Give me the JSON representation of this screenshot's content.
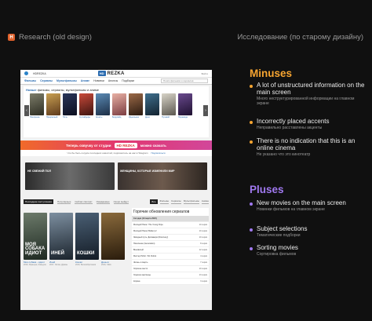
{
  "header": {
    "left_badge": "H",
    "left_label": "Research (old design)",
    "right_label": "Исследование (по старому дизайну)"
  },
  "site": {
    "top_left_text": "HDREZKA",
    "brand_badge": "HD",
    "brand_name": "REZKA",
    "top_right_text": "Войти",
    "nav": [
      "Фильмы",
      "Сериалы",
      "Мультфильмы",
      "Аниме",
      "Новинки",
      "Анонсы",
      "Подборки"
    ],
    "search_placeholder": "Поиск фильмов и сериалов",
    "new_title_prefix": "Новые",
    "new_title_rest": "фильмы, сериалы, мультфильмы и аниме",
    "poster_captions": [
      "Покорение",
      "Прекрасный",
      "Ночь",
      "Аутсайдеры",
      "Агенты",
      "Бердсайд",
      "Идеальная",
      "Дело",
      "Нулевой",
      "Пирамида"
    ],
    "banner_text": "Теперь озвучку от студии",
    "banner_logo": "HD REZKA",
    "banner_suffix": "можно скачать",
    "tg_text": "Что бы быть в курсе последних новостей, подпишитесь на нас в Telegram",
    "tg_subscribe": "Подписаться",
    "collections": [
      "НЕ СВЕЖИЙ ПОЛ",
      "ЖЕНЩИНЫ, КОТОРЫЕ ИЗМЕНИЛИ МИР"
    ],
    "tabs": [
      "Последние поступления",
      "Популярные",
      "Сейчас смотрят",
      "Ожидаемые",
      "Скоро выйдут"
    ],
    "tabs_right": [
      "Все",
      "Фильмы",
      "Сериалы",
      "Мультфильмы",
      "Аниме"
    ],
    "lower_posters": [
      {
        "title": "МОЯ СОБАКА ИДИОТ",
        "cap": "Моя собака - идиот",
        "cap2": "2019, Франция, Комедия"
      },
      {
        "title": "ИНЕЙ",
        "cap": "Иней",
        "cap2": "2017, Литва, Драмы"
      },
      {
        "title": "КОШКИ",
        "cap": "Кошки",
        "cap2": "2019, Великобритания"
      },
      {
        "title": "",
        "cap": "Деньги",
        "cap2": "2019, США"
      }
    ],
    "updates_title": "Горячие обновления сериалов",
    "updates_head": "Сегодня (19 марта 2020)",
    "updates": [
      {
        "name": "Молодой Папа / The Young Pope",
        "ep": "10 серия"
      },
      {
        "name": "Молодой Папа (Hidden) 2",
        "ep": "10 серия"
      },
      {
        "name": "Звёздный путь: Дискавери (Discovery)",
        "ep": "10 серия"
      },
      {
        "name": "Поколение (Generation)",
        "ep": "8 серия"
      },
      {
        "name": "Виноватый",
        "ep": "12 серия"
      },
      {
        "name": "Мистер Робот / Mr. Robot",
        "ep": "4 серия"
      },
      {
        "name": "Жизнь и смерть",
        "ep": "7 серия"
      },
      {
        "name": "Хорошее место",
        "ep": "10 серия"
      },
      {
        "name": "Ходячие мертвецы",
        "ep": "13 серия"
      },
      {
        "name": "Корона",
        "ep": "3 серия"
      }
    ]
  },
  "minuses": {
    "title": "Minuses",
    "items": [
      {
        "title": "A lot of unstructured information on the main screen",
        "sub": "Много неструктурированной информации на главном экране"
      },
      {
        "title": "Incorrectly placed accents",
        "sub": "Неправильно расставлены акценты"
      },
      {
        "title": "There is no indication that this is an online cinema",
        "sub": "Не указано что это кинотеатр"
      }
    ]
  },
  "pluses": {
    "title": "Pluses",
    "items": [
      {
        "title": "New movies on the main screen",
        "sub": "Новинки фильмов на главном экране"
      },
      {
        "title": "Subject selections",
        "sub": "Тематические подборки"
      },
      {
        "title": "Sorting movies",
        "sub": "Сортировка фильмов"
      }
    ]
  },
  "colors": {
    "minus_accent": "#f7a531",
    "plus_accent": "#a079f0",
    "background": "#101010"
  }
}
